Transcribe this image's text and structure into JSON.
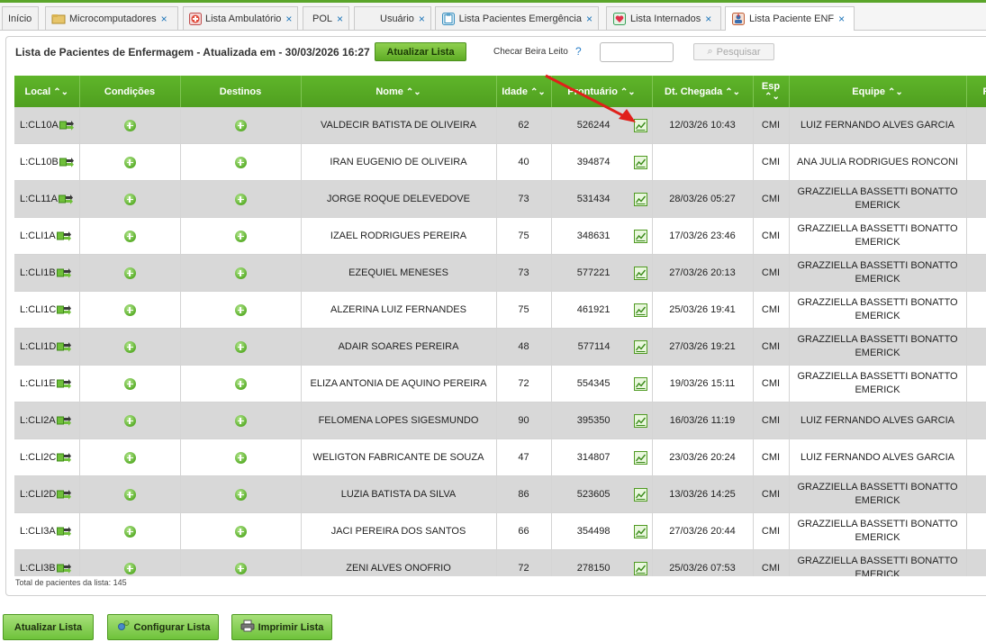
{
  "tabs": [
    {
      "label": "Início",
      "icon": "none",
      "closable": false
    },
    {
      "label": "Microcomputadores",
      "icon": "folder-icon",
      "closable": true
    },
    {
      "label": "Lista Ambulatório",
      "icon": "medical-icon",
      "closable": true
    },
    {
      "label": "POL",
      "icon": "none",
      "closable": true
    },
    {
      "label": "Usuário",
      "icon": "none",
      "closable": true
    },
    {
      "label": "Lista Pacientes Emergência",
      "icon": "clipboard-icon",
      "closable": true
    },
    {
      "label": "Lista Internados",
      "icon": "heart-icon",
      "closable": true
    },
    {
      "label": "Lista Paciente ENF",
      "icon": "nurse-icon",
      "closable": true,
      "active": true
    }
  ],
  "header": {
    "title": "Lista de Pacientes de Enfermagem - Atualizada em - 30/03/2026 16:27",
    "refresh_button": "Atualizar Lista",
    "check_label": "Checar Beira Leito",
    "help": "?",
    "search_button": "Pesquisar"
  },
  "columns": [
    "Local",
    "Condições",
    "Destinos",
    "Nome",
    "Idade",
    "Prontuário",
    "Dt. Chegada",
    "Esp",
    "Equipe",
    "R"
  ],
  "rows": [
    {
      "local": "L:CL10A",
      "nome": "VALDECIR BATISTA DE OLIVEIRA",
      "idade": "62",
      "prontuario": "526244",
      "chegada": "12/03/26 10:43",
      "esp": "CMI",
      "equipe": "LUIZ FERNANDO ALVES GARCIA"
    },
    {
      "local": "L:CL10B",
      "nome": "IRAN EUGENIO DE OLIVEIRA",
      "idade": "40",
      "prontuario": "394874",
      "chegada": "",
      "esp": "CMI",
      "equipe": "ANA JULIA RODRIGUES RONCONI"
    },
    {
      "local": "L:CL11A",
      "nome": "JORGE ROQUE DELEVEDOVE",
      "idade": "73",
      "prontuario": "531434",
      "chegada": "28/03/26 05:27",
      "esp": "CMI",
      "equipe": "GRAZZIELLA BASSETTI BONATTO EMERICK"
    },
    {
      "local": "L:CLI1A",
      "nome": "IZAEL RODRIGUES PEREIRA",
      "idade": "75",
      "prontuario": "348631",
      "chegada": "17/03/26 23:46",
      "esp": "CMI",
      "equipe": "GRAZZIELLA BASSETTI BONATTO EMERICK"
    },
    {
      "local": "L:CLI1B",
      "nome": "EZEQUIEL MENESES",
      "idade": "73",
      "prontuario": "577221",
      "chegada": "27/03/26 20:13",
      "esp": "CMI",
      "equipe": "GRAZZIELLA BASSETTI BONATTO EMERICK"
    },
    {
      "local": "L:CLI1C",
      "nome": "ALZERINA LUIZ FERNANDES",
      "idade": "75",
      "prontuario": "461921",
      "chegada": "25/03/26 19:41",
      "esp": "CMI",
      "equipe": "GRAZZIELLA BASSETTI BONATTO EMERICK"
    },
    {
      "local": "L:CLI1D",
      "nome": "ADAIR SOARES PEREIRA",
      "idade": "48",
      "prontuario": "577114",
      "chegada": "27/03/26 19:21",
      "esp": "CMI",
      "equipe": "GRAZZIELLA BASSETTI BONATTO EMERICK"
    },
    {
      "local": "L:CLI1E",
      "nome": "ELIZA ANTONIA DE AQUINO PEREIRA",
      "idade": "72",
      "prontuario": "554345",
      "chegada": "19/03/26 15:11",
      "esp": "CMI",
      "equipe": "GRAZZIELLA BASSETTI BONATTO EMERICK"
    },
    {
      "local": "L:CLI2A",
      "nome": "FELOMENA LOPES SIGESMUNDO",
      "idade": "90",
      "prontuario": "395350",
      "chegada": "16/03/26 11:19",
      "esp": "CMI",
      "equipe": "LUIZ FERNANDO ALVES GARCIA"
    },
    {
      "local": "L:CLI2C",
      "nome": "WELIGTON FABRICANTE DE SOUZA",
      "idade": "47",
      "prontuario": "314807",
      "chegada": "23/03/26 20:24",
      "esp": "CMI",
      "equipe": "LUIZ FERNANDO ALVES GARCIA"
    },
    {
      "local": "L:CLI2D",
      "nome": "LUZIA BATISTA DA SILVA",
      "idade": "86",
      "prontuario": "523605",
      "chegada": "13/03/26 14:25",
      "esp": "CMI",
      "equipe": "GRAZZIELLA BASSETTI BONATTO EMERICK"
    },
    {
      "local": "L:CLI3A",
      "nome": "JACI PEREIRA DOS SANTOS",
      "idade": "66",
      "prontuario": "354498",
      "chegada": "27/03/26 20:44",
      "esp": "CMI",
      "equipe": "GRAZZIELLA BASSETTI BONATTO EMERICK"
    },
    {
      "local": "L:CLI3B",
      "nome": "ZENI ALVES ONOFRIO",
      "idade": "72",
      "prontuario": "278150",
      "chegada": "25/03/26 07:53",
      "esp": "CMI",
      "equipe": "GRAZZIELLA BASSETTI BONATTO EMERICK"
    }
  ],
  "footer": {
    "total": "Total de pacientes da lista: 145"
  },
  "bottom_buttons": [
    {
      "label": "Atualizar Lista",
      "icon": "none"
    },
    {
      "label": "Configurar Lista",
      "icon": "settings-icon"
    },
    {
      "label": "Imprimir Lista",
      "icon": "printer-icon"
    }
  ],
  "colors": {
    "accent": "#5aa52a",
    "header_green": "#4f9f1f",
    "row_alt": "#d8d8d8",
    "tab_close": "#1a73b8",
    "arrow": "#e0201a"
  }
}
